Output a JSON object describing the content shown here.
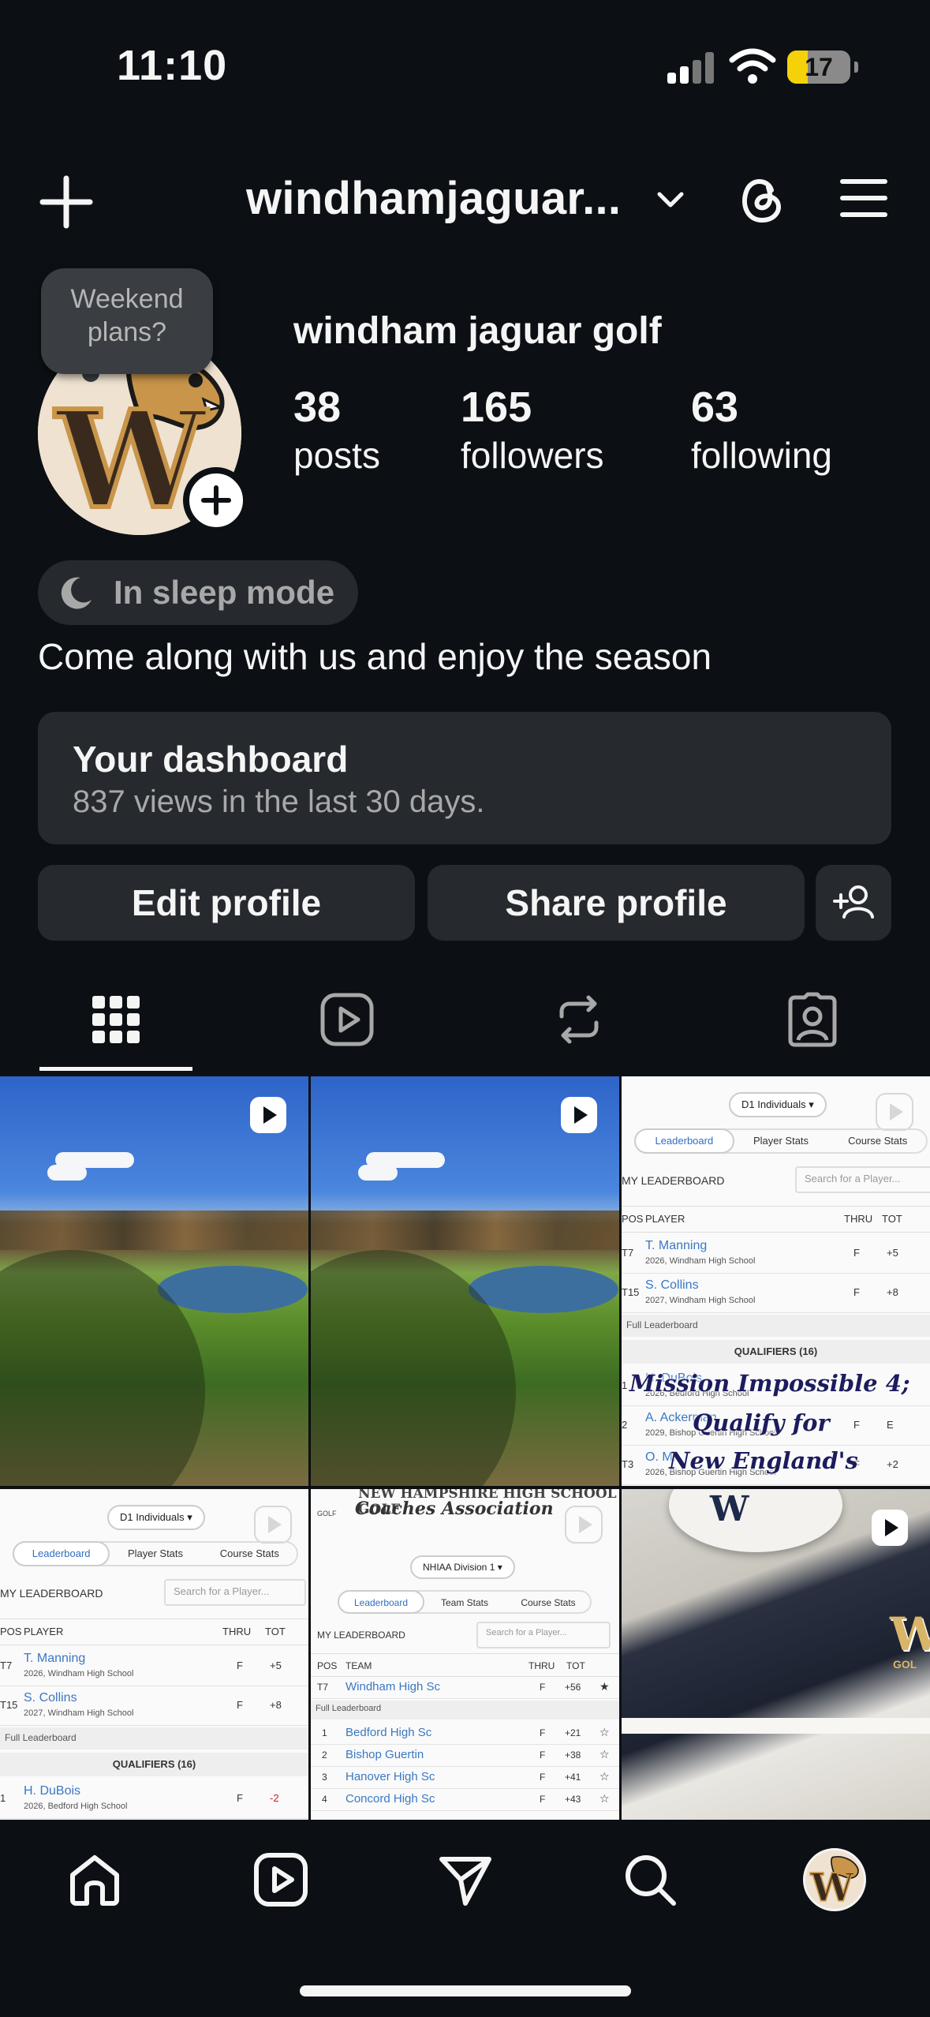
{
  "status_bar": {
    "time": "11:10",
    "battery_level": "17",
    "battery_color": "#f5d10a"
  },
  "header": {
    "username": "windhamjaguar...",
    "icons": [
      "plus-icon",
      "chevron-down-icon",
      "threads-icon",
      "menu-icon"
    ]
  },
  "profile": {
    "note": "Weekend plans?",
    "display_name": "windham jaguar golf",
    "stats": [
      {
        "value": "38",
        "label": "posts"
      },
      {
        "value": "165",
        "label": "followers"
      },
      {
        "value": "63",
        "label": "following"
      }
    ],
    "avatar_letter": "W",
    "sleep_badge": "In sleep mode",
    "bio": "Come along with us and enjoy the season"
  },
  "dashboard": {
    "title": "Your dashboard",
    "subtitle": "837 views in the last 30 days."
  },
  "actions": {
    "edit": "Edit profile",
    "share": "Share profile"
  },
  "tabs": [
    "grid-icon",
    "reels-icon",
    "reposts-icon",
    "tagged-icon"
  ],
  "leaderboard_a": {
    "dropdown": "D1 Individuals ▾",
    "tabs": [
      "Leaderboard",
      "Player Stats",
      "Course Stats"
    ],
    "caption": "MY LEADERBOARD",
    "search": "Search for a Player...",
    "columns": [
      "POS",
      "PLAYER",
      "THRU",
      "TOT"
    ],
    "mine": [
      {
        "pos": "T7",
        "name": "T. Manning",
        "school": "2026, Windham High School",
        "thru": "F",
        "tot": "+5"
      },
      {
        "pos": "T15",
        "name": "S. Collins",
        "school": "2027, Windham High School",
        "thru": "F",
        "tot": "+8"
      }
    ],
    "full_label": "Full Leaderboard",
    "qualifiers": "QUALIFIERS (16)",
    "rest": [
      {
        "pos": "1",
        "name": "H. DuBois",
        "school": "2026, Bedford High School",
        "thru": "F",
        "tot": "-2"
      },
      {
        "pos": "2",
        "name": "A. Ackerman",
        "school": "2029, Bishop Guertin High School",
        "thru": "F",
        "tot": "E"
      },
      {
        "pos": "T3",
        "name": "O. M...",
        "school": "2026, Bishop Guertin High School",
        "thru": "F",
        "tot": "+2"
      }
    ],
    "overlay_lines": [
      "Mission Impossible 4;",
      "Qualify for",
      "New England's"
    ]
  },
  "leaderboard_b": {
    "banner_line1": "NEW HAMPSHIRE HIGH SCHOOL GOLF",
    "banner_line2": "Coaches Association",
    "logo_text": "GOLF",
    "dropdown": "NHIAA Division 1 ▾",
    "tabs": [
      "Leaderboard",
      "Team Stats",
      "Course Stats"
    ],
    "caption": "MY LEADERBOARD",
    "search": "Search for a Player...",
    "columns": [
      "POS",
      "TEAM",
      "THRU",
      "TOT"
    ],
    "mine": [
      {
        "pos": "T7",
        "name": "Windham High Sc",
        "thru": "F",
        "tot": "+56"
      }
    ],
    "full_label": "Full Leaderboard",
    "rest": [
      {
        "pos": "1",
        "name": "Bedford High Sc",
        "thru": "F",
        "tot": "+21"
      },
      {
        "pos": "2",
        "name": "Bishop Guertin",
        "thru": "F",
        "tot": "+38"
      },
      {
        "pos": "3",
        "name": "Hanover High Sc",
        "thru": "F",
        "tot": "+41"
      },
      {
        "pos": "4",
        "name": "Concord High Sc",
        "thru": "F",
        "tot": "+43"
      }
    ]
  },
  "apparel_logo": "W",
  "apparel_sub": "GOL",
  "bottom_nav": [
    "home-icon",
    "reels-icon",
    "messages-icon",
    "search-icon",
    "profile-avatar"
  ]
}
